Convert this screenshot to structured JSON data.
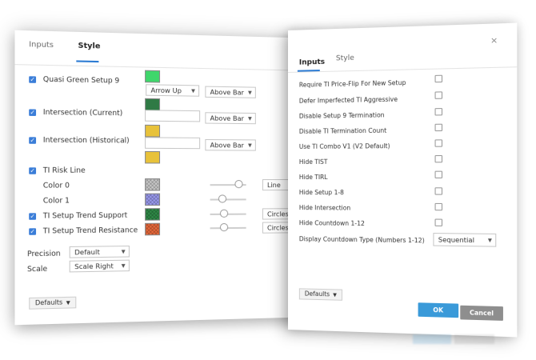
{
  "style_dialog": {
    "tabs": [
      {
        "label": "Inputs"
      },
      {
        "label": "Style"
      }
    ],
    "rows": [
      {
        "label": "Quasi Green Setup 9",
        "checked": true,
        "color": "#3fd66b"
      },
      {
        "label": "Intersection (Current)",
        "checked": true,
        "color": ""
      },
      {
        "label": "Intersection (Historical)",
        "checked": true,
        "color": ""
      },
      {
        "label": "TI Risk Line",
        "checked": true
      },
      {
        "label": "Color 0",
        "checked": false,
        "color": "#b8b8b8"
      },
      {
        "label": "Color 1",
        "checked": false,
        "color": "#8f8fe8"
      },
      {
        "label": "TI Setup Trend Support",
        "checked": true,
        "color": "#2f8a47"
      },
      {
        "label": "TI Setup Trend Resistance",
        "checked": true,
        "color": "#e8693b"
      }
    ],
    "extra_swatches": {
      "dark_green": "#2f7a45",
      "yellow_1": "#e8c23a",
      "yellow_2": "#e8c23a"
    },
    "arrow_up_label": "Arrow Up",
    "above_bar_labels": [
      "Above Bar",
      "Above Bar",
      "Above Bar"
    ],
    "line_label": "Line",
    "circles_labels": [
      "Circles",
      "Circles"
    ],
    "precision_label": "Precision",
    "precision_value": "Default",
    "scale_label": "Scale",
    "scale_value": "Scale Right",
    "defaults_label": "Defaults"
  },
  "inputs_dialog": {
    "tabs": [
      {
        "label": "Inputs"
      },
      {
        "label": "Style"
      }
    ],
    "close_symbol": "×",
    "options": [
      {
        "label": "Require TI Price-Flip For New Setup",
        "checked": false
      },
      {
        "label": "Defer Imperfected TI Aggressive",
        "checked": false
      },
      {
        "label": "Disable Setup 9 Termination",
        "checked": false
      },
      {
        "label": "Disable TI Termination Count",
        "checked": false
      },
      {
        "label": "Use TI Combo V1 (V2 Default)",
        "checked": false
      },
      {
        "label": "Hide TIST",
        "checked": false
      },
      {
        "label": "Hide TIRL",
        "checked": false
      },
      {
        "label": "Hide Setup 1-8",
        "checked": false
      },
      {
        "label": "Hide Intersection",
        "checked": false
      },
      {
        "label": "Hide Countdown 1-12",
        "checked": false
      }
    ],
    "display_countdown_label": "Display Countdown Type (Numbers 1-12)",
    "display_countdown_value": "Sequential",
    "defaults_label": "Defaults",
    "ok_label": "OK",
    "cancel_label": "Cancel"
  },
  "colors": {
    "accent": "#2c7bd3",
    "ok": "#3a9ad9",
    "cancel": "#8e8e8e"
  }
}
